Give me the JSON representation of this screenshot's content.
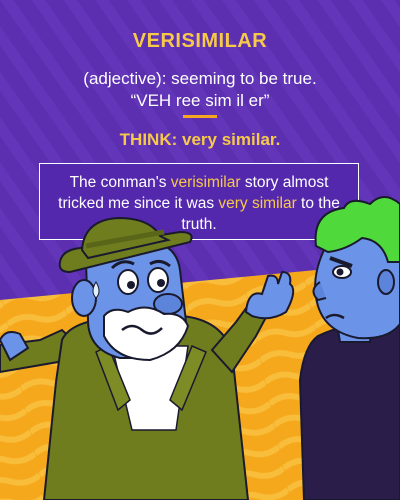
{
  "word": "VERISIMILAR",
  "definition": {
    "part_of_speech_line": "(adjective): seeming to be true.",
    "pronunciation": "“VEH ree sim il er”"
  },
  "think": {
    "label": "THINK:",
    "text": "very similar."
  },
  "example": {
    "before": "The conman's ",
    "word": "verisimilar",
    "middle": " story almost tricked me since it was ",
    "phrase": "very similar",
    "after": " to the truth."
  },
  "colors": {
    "background_purple": "#5b2fb0",
    "accent_yellow": "#f7c94a",
    "accent_orange": "#f5a623",
    "text_white": "#ffffff",
    "floor_orange": "#f5a81c"
  },
  "illustration": {
    "left_figure": "nervous old man in green hat and green jacket, shrugging",
    "right_figure": "angry man with green hair in dark shirt"
  }
}
